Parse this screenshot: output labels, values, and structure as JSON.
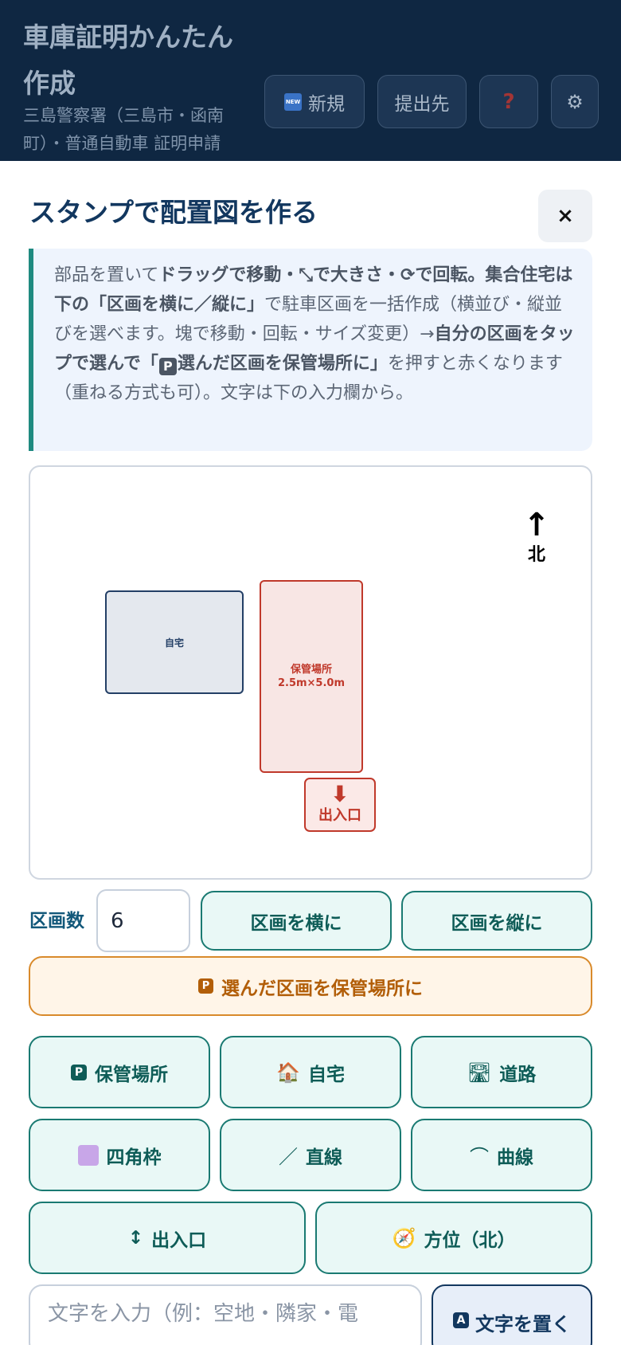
{
  "header": {
    "title": "車庫証明かんたん作成",
    "subtitle": "三島警察署（三島市・函南町）・普通自動車 証明申請",
    "new_badge": "NEW",
    "new_label": "新規",
    "submit_label": "提出先",
    "help_glyph": "?",
    "gear_glyph": "⚙"
  },
  "sheet": {
    "title": "スタンプで配置図を作る",
    "close_glyph": "×"
  },
  "info": {
    "p1": "部品を置いて",
    "b1": "ドラッグで移動・⤡で大きさ・⟳で回転。集合住宅は下の「区画を横に／縦に」",
    "p2": "で駐車区画を一括作成（横並び・縦並びを選べます。塊で移動・回転・サイズ変更）→",
    "b2a": "自分の区画をタップで選んで「",
    "badge": "P",
    "b2b": "選んだ区画を保管場所に」",
    "p3": "を押すと赤くなります（重ねる方式も可）。文字は下の入力欄から。"
  },
  "canvas": {
    "north_arrow": "↑",
    "north_label": "北",
    "house_label": "自宅",
    "parking_label": "保管場所",
    "parking_size": "2.5m×5.0m",
    "entrance_arrow": "⬇",
    "entrance_label": "出入口"
  },
  "controls": {
    "count_label": "区画数",
    "count_value": "6",
    "horizontal_label": "区画を横に",
    "vertical_label": "区画を縦に",
    "assign_badge": "P",
    "assign_label": "選んだ区画を保管場所に"
  },
  "stamps": {
    "parking_badge": "P",
    "parking": "保管場所",
    "home_icon": "🏠",
    "home": "自宅",
    "road_icon": "🛣",
    "road": "道路",
    "rect": "四角枠",
    "line_icon": "／",
    "line": "直線",
    "curve_icon": "⌒",
    "curve": "曲線",
    "entrance_icon": "↕",
    "entrance": "出入口",
    "compass_icon": "🧭",
    "compass": "方位（北）"
  },
  "text_tool": {
    "placeholder": "文字を入力（例：空地・隣家・電",
    "a_badge": "A",
    "place_label": "文字を置く"
  }
}
